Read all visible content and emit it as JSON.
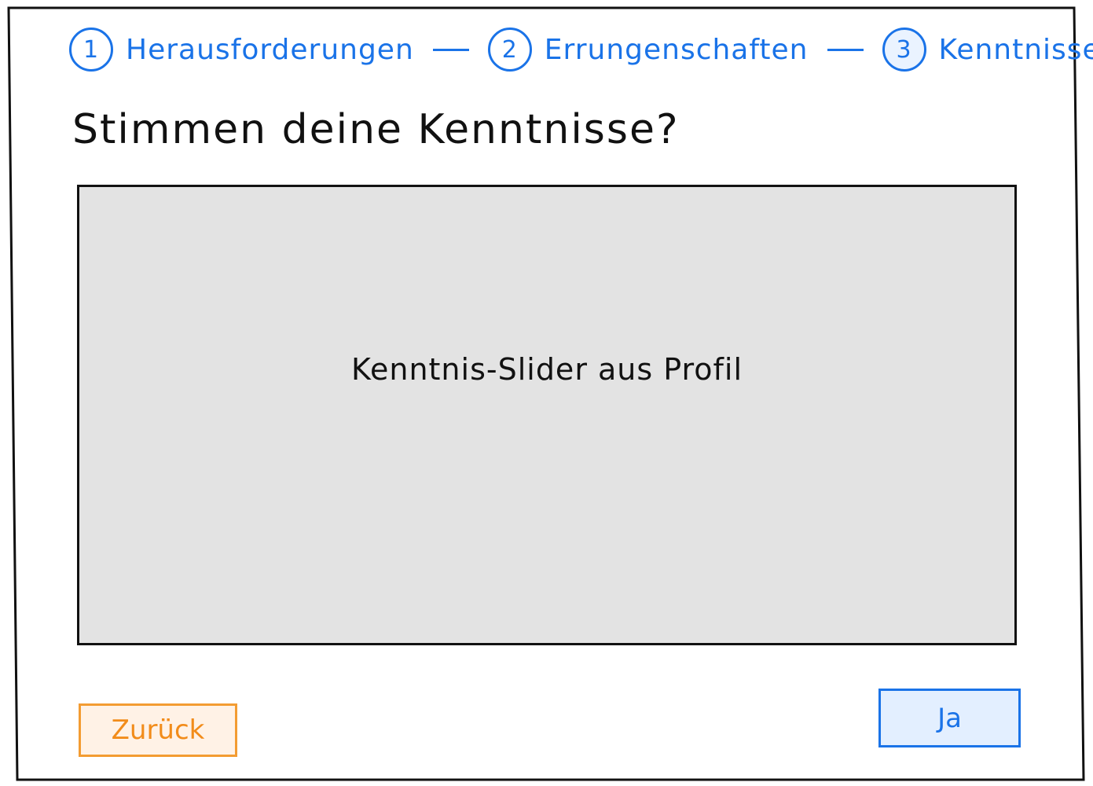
{
  "stepper": {
    "steps": [
      {
        "number": "1",
        "label": "Herausforderungen"
      },
      {
        "number": "2",
        "label": "Errungenschaften"
      },
      {
        "number": "3",
        "label": "Kenntnisse"
      }
    ]
  },
  "question": {
    "text": "Stimmen deine Kenntnisse?"
  },
  "placeholder": {
    "label": "Kenntnis-Slider aus Profil"
  },
  "actions": {
    "back_label": "Zurück",
    "confirm_label": "Ja"
  },
  "colors": {
    "accent": "#1a73e8",
    "secondary": "#f39c32",
    "placeholder_bg": "#e3e3e3"
  }
}
